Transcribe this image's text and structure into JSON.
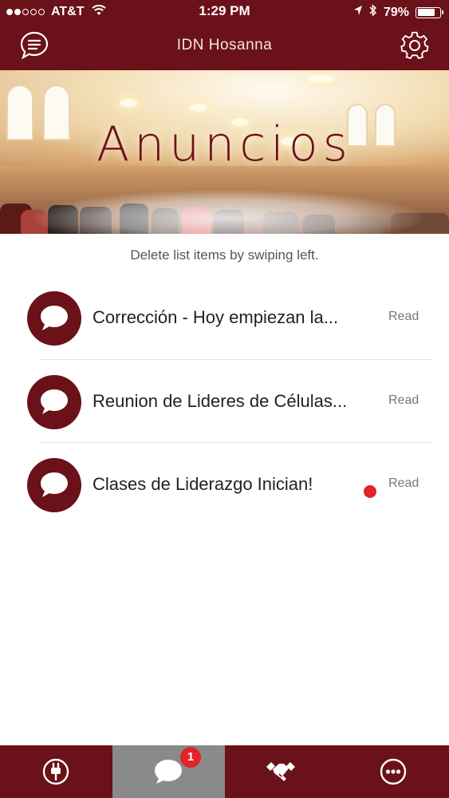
{
  "status_bar": {
    "signal_bars": 2,
    "signal_total": 5,
    "carrier": "AT&T",
    "time": "1:29 PM",
    "battery_text": "79%",
    "battery_level": 0.79,
    "icons": [
      "wifi-icon",
      "location-arrow-icon",
      "bluetooth-icon",
      "battery-icon"
    ]
  },
  "navbar": {
    "title": "IDN Hosanna",
    "left_icon": "chat-list-icon",
    "right_icon": "gear-icon"
  },
  "banner": {
    "title": "Anuncios"
  },
  "hint": "Delete list items by swiping left.",
  "announcements": [
    {
      "title": "Corrección - Hoy empiezan la...",
      "status": "Read",
      "unread": false
    },
    {
      "title": "Reunion de Lideres de Células...",
      "status": "Read",
      "unread": false
    },
    {
      "title": "Clases de Liderazgo Inician!",
      "status": "Read",
      "unread": true
    }
  ],
  "tabbar": {
    "tabs": [
      {
        "icon": "plug-icon",
        "selected": false
      },
      {
        "icon": "chat-bubble-icon",
        "selected": true,
        "badge": "1"
      },
      {
        "icon": "handshake-icon",
        "selected": false
      },
      {
        "icon": "more-icon",
        "selected": false
      }
    ]
  },
  "colors": {
    "brand": "#6b1119",
    "selected_tab": "#8a8a8a",
    "badge": "#e0242a",
    "unread_dot": "#e0242a"
  }
}
